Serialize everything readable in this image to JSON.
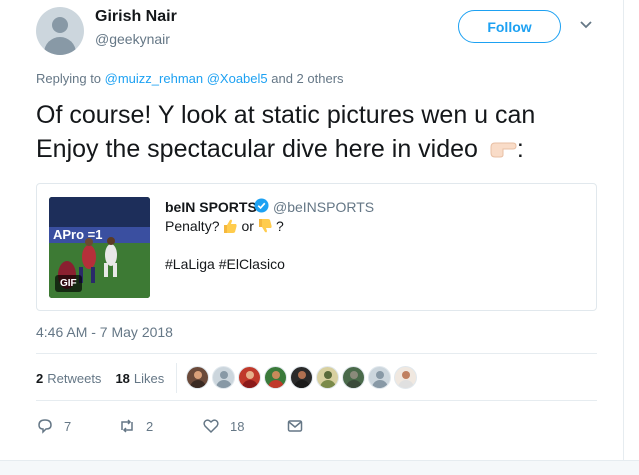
{
  "author": {
    "name": "Girish Nair",
    "handle": "@geekynair",
    "follow_label": "Follow"
  },
  "reply_context": {
    "prefix": "Replying to ",
    "mentions": [
      "@muizz_rehman",
      "@Xoabel5"
    ],
    "suffix": " and 2 others"
  },
  "tweet": {
    "line1": "Of course! Y look at static pictures wen u can",
    "line2": "Enjoy the spectacular dive here in video",
    "line2_end": ":"
  },
  "quote": {
    "name": "beIN SPORTS",
    "handle": "@beINSPORTS",
    "text_a": "Penalty?",
    "text_b": "or",
    "text_c": "?",
    "hashtags": "#LaLiga #ElClasico",
    "media_badge": "GIF",
    "media_caption": "APro =1"
  },
  "timestamp": "4:46 AM - 7 May 2018",
  "stats": {
    "retweets_count": "2",
    "retweets_label": "Retweets",
    "likes_count": "18",
    "likes_label": "Likes"
  },
  "actions": {
    "replies": "7",
    "retweets": "2",
    "likes": "18"
  },
  "colors": {
    "accent": "#1da1f2",
    "secondary_text": "#657786",
    "primary_text": "#14171a",
    "border": "#e1e8ed"
  },
  "icons": [
    "chevron-down-icon",
    "verified-icon",
    "thumbs-up-emoji",
    "thumbs-down-emoji",
    "pointing-right-emoji",
    "reply-icon",
    "retweet-icon",
    "heart-icon",
    "direct-message-icon"
  ]
}
